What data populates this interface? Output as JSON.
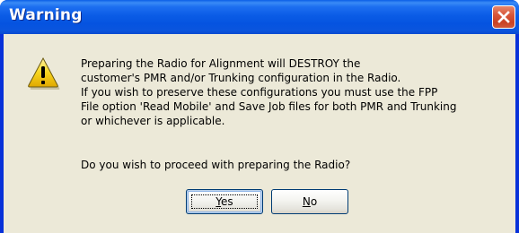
{
  "window": {
    "title": "Warning"
  },
  "dialog": {
    "icon": "warning-icon",
    "message": "Preparing the Radio for Alignment will DESTROY the\ncustomer's PMR and/or Trunking configuration in the Radio.\nIf you wish to preserve these configurations you must use the FPP\nFile option 'Read Mobile' and Save Job files for both PMR and Trunking\nor whichever is applicable.",
    "question": "Do you wish to proceed with preparing the Radio?"
  },
  "buttons": {
    "yes": {
      "accel": "Y",
      "rest": "es"
    },
    "no": {
      "accel": "N",
      "rest": "o"
    }
  },
  "colors": {
    "titlebar": "#0a55de",
    "close": "#c94224",
    "client": "#ece9d8",
    "icon_yellow": "#f7d51e"
  }
}
